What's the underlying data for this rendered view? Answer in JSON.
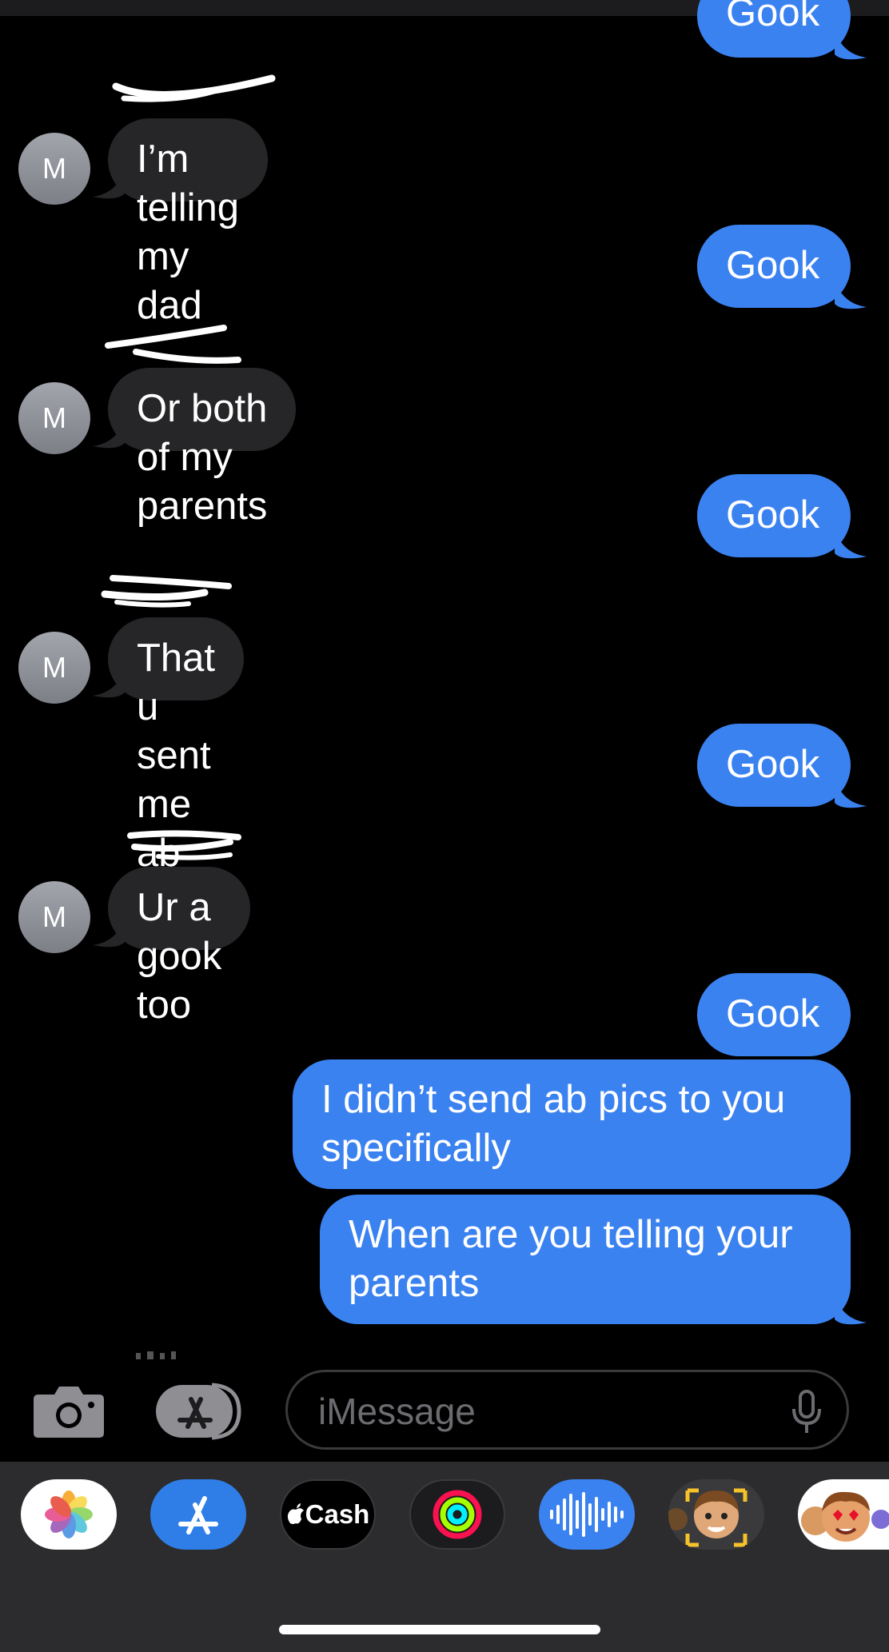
{
  "messages": [
    {
      "side": "sent",
      "text": "Gook"
    },
    {
      "side": "received",
      "avatar": "M",
      "text": "I’m telling my dad"
    },
    {
      "side": "sent",
      "text": "Gook"
    },
    {
      "side": "received",
      "avatar": "M",
      "text": "Or both of my parents"
    },
    {
      "side": "sent",
      "text": "Gook"
    },
    {
      "side": "received",
      "avatar": "M",
      "text": "That u sent me ab pics"
    },
    {
      "side": "sent",
      "text": "Gook"
    },
    {
      "side": "received",
      "avatar": "M",
      "text": "Ur a gook too"
    },
    {
      "side": "sent",
      "text": "Gook"
    },
    {
      "side": "sent",
      "text": "I didn’t send ab pics to you specifically"
    },
    {
      "side": "sent",
      "text": "When are you telling your parents"
    }
  ],
  "input": {
    "placeholder": "iMessage"
  },
  "app_drawer": {
    "apps": [
      {
        "name": "photos-icon"
      },
      {
        "name": "app-store-icon"
      },
      {
        "name": "apple-cash-icon",
        "label": "Cash"
      },
      {
        "name": "fitness-rings-icon"
      },
      {
        "name": "audio-message-icon"
      },
      {
        "name": "memoji-sticker-icon"
      },
      {
        "name": "animoji-icon"
      }
    ]
  },
  "colors": {
    "sent": "#3b82f1",
    "received": "#262628",
    "background": "#000000",
    "drawer": "#2c2c2e"
  }
}
